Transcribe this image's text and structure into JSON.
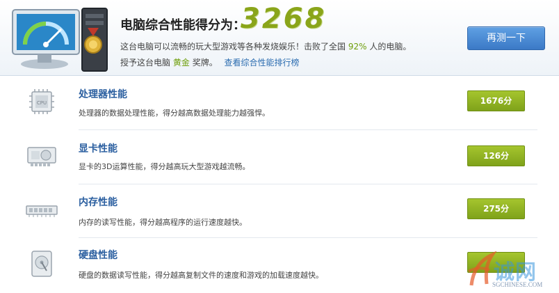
{
  "header": {
    "score_label": "电脑综合性能得分为：",
    "score_value": "3268",
    "summary_prefix": "这台电脑可以流畅的玩大型游戏等各种发烧娱乐！击败了全国",
    "summary_percent": "92%",
    "summary_suffix": "人的电脑。",
    "medal_prefix": "授予这台电脑",
    "medal_name": "黄金",
    "medal_suffix": "奖牌。",
    "ranking_link": "查看综合性能排行榜",
    "retest_button": "再测一下"
  },
  "items": [
    {
      "title": "处理器性能",
      "desc": "处理器的数据处理性能，得分越高数据处理能力越强悍。",
      "score": "1676分",
      "icon": "cpu-icon"
    },
    {
      "title": "显卡性能",
      "desc": "显卡的3D运算性能，得分越高玩大型游戏越流畅。",
      "score": "126分",
      "icon": "graphics-card-icon"
    },
    {
      "title": "内存性能",
      "desc": "内存的读写性能，得分越高程序的运行速度越快。",
      "score": "275分",
      "icon": "memory-icon"
    },
    {
      "title": "硬盘性能",
      "desc": "硬盘的数据读写性能，得分越高复制文件的速度和游戏的加载速度越快。",
      "score": "",
      "icon": "hard-disk-icon"
    }
  ],
  "watermark": {
    "text": "诚网",
    "url": "SGCHINESE.COM"
  },
  "colors": {
    "accent_green": "#8aa51a",
    "link_blue": "#2b6cb0",
    "button_blue": "#3b79c6"
  }
}
